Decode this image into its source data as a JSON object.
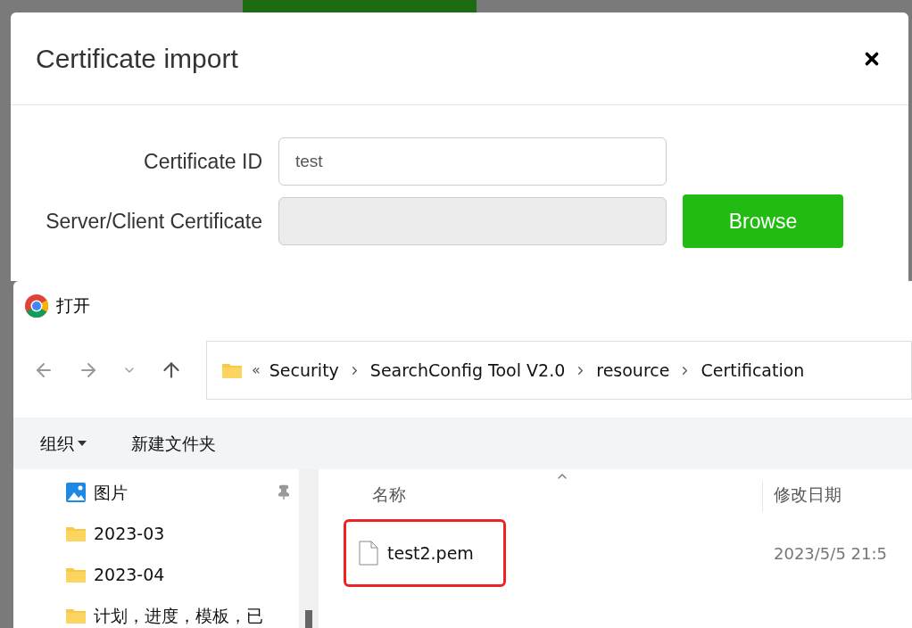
{
  "modal": {
    "title": "Certificate import",
    "fields": [
      {
        "label": "Certificate ID",
        "value": "test",
        "disabled": false
      },
      {
        "label": "Server/Client Certificate",
        "disabled": true
      }
    ],
    "browse_button": "Browse"
  },
  "file_dialog": {
    "title": "打开",
    "path_overflow": "«",
    "path": [
      "Security",
      "SearchConfig Tool V2.0",
      "resource",
      "Certification"
    ],
    "toolbar": [
      {
        "label": "组织",
        "kind": "menu"
      },
      {
        "label": "新建文件夹",
        "kind": "button"
      }
    ],
    "nav_items": [
      {
        "label": "图片",
        "kind": "pictures",
        "pinned": true
      },
      {
        "label": "2023-03",
        "kind": "folder",
        "pinned": false
      },
      {
        "label": "2023-04",
        "kind": "folder",
        "pinned": false
      },
      {
        "label": "计划，进度，模板，已",
        "kind": "folder",
        "pinned": false
      }
    ],
    "columns": [
      "名称",
      "修改日期"
    ],
    "files": [
      {
        "name": "test2.pem",
        "modified": "2023/5/5 21:5",
        "highlighted": true
      }
    ]
  }
}
